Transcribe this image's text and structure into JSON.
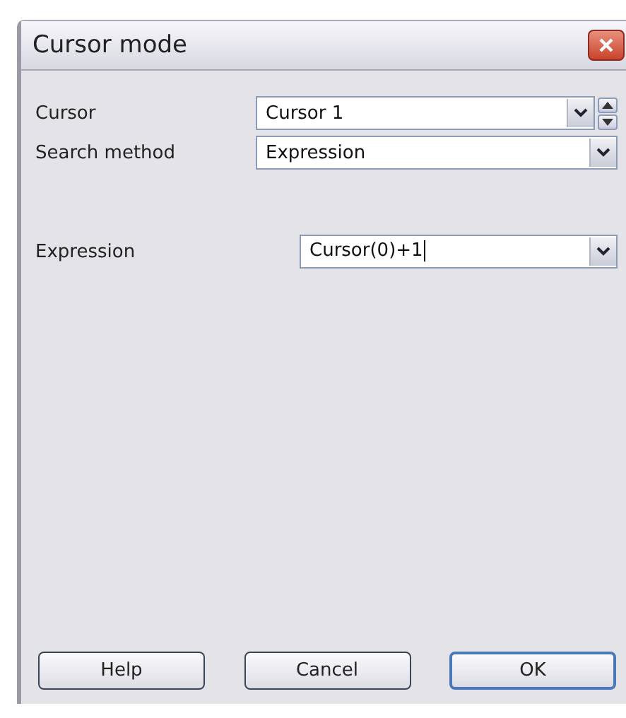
{
  "window": {
    "title": "Cursor mode"
  },
  "fields": [
    {
      "label": "Cursor",
      "value": "Cursor 1",
      "kind": "spin-combo",
      "caret": false
    },
    {
      "label": "Search method",
      "value": "Expression",
      "kind": "combo",
      "caret": false
    },
    {
      "label": "Expression",
      "value": "Cursor(0)+1",
      "kind": "edit-combo",
      "caret": true
    }
  ],
  "buttons": [
    {
      "label": "Help",
      "default": false
    },
    {
      "label": "Cancel",
      "default": false
    },
    {
      "label": "OK",
      "default": true
    }
  ]
}
